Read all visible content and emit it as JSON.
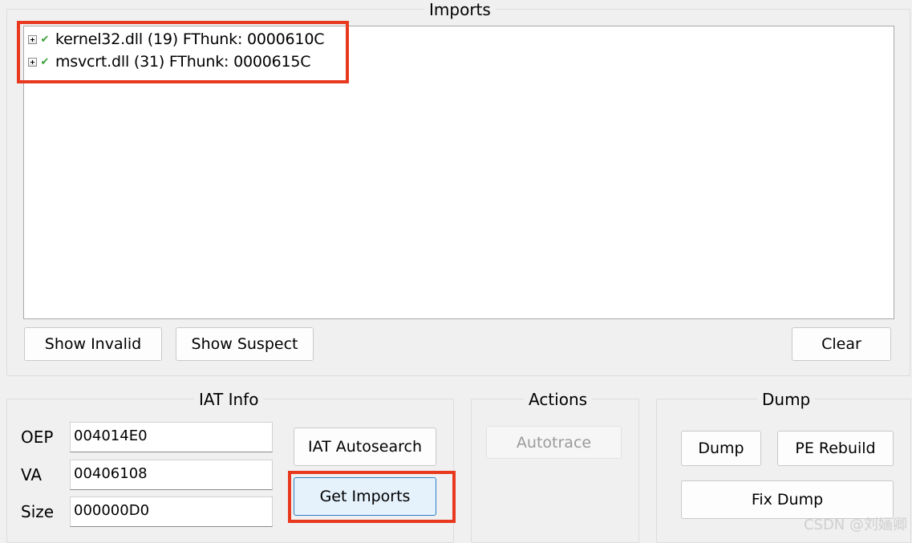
{
  "imports": {
    "group_title": "Imports",
    "tree_items": [
      {
        "label": "kernel32.dll (19) FThunk: 0000610C"
      },
      {
        "label": "msvcrt.dll (31) FThunk: 0000615C"
      }
    ],
    "buttons": {
      "show_invalid": "Show Invalid",
      "show_suspect": "Show Suspect",
      "clear": "Clear"
    }
  },
  "iat_info": {
    "group_title": "IAT Info",
    "oep_label": "OEP",
    "oep_value": "004014E0",
    "va_label": "VA",
    "va_value": "00406108",
    "size_label": "Size",
    "size_value": "000000D0",
    "iat_autosearch": "IAT Autosearch",
    "get_imports": "Get Imports"
  },
  "actions": {
    "group_title": "Actions",
    "autotrace": "Autotrace"
  },
  "dump": {
    "group_title": "Dump",
    "dump_button": "Dump",
    "pe_rebuild": "PE Rebuild",
    "fix_dump": "Fix Dump"
  },
  "watermark": "CSDN @刘婳卿",
  "colors": {
    "highlight_border": "#e8391f",
    "active_button_bg": "#e5f1fb",
    "active_button_border": "#2f7ec9",
    "check_green": "#3aa03a"
  }
}
